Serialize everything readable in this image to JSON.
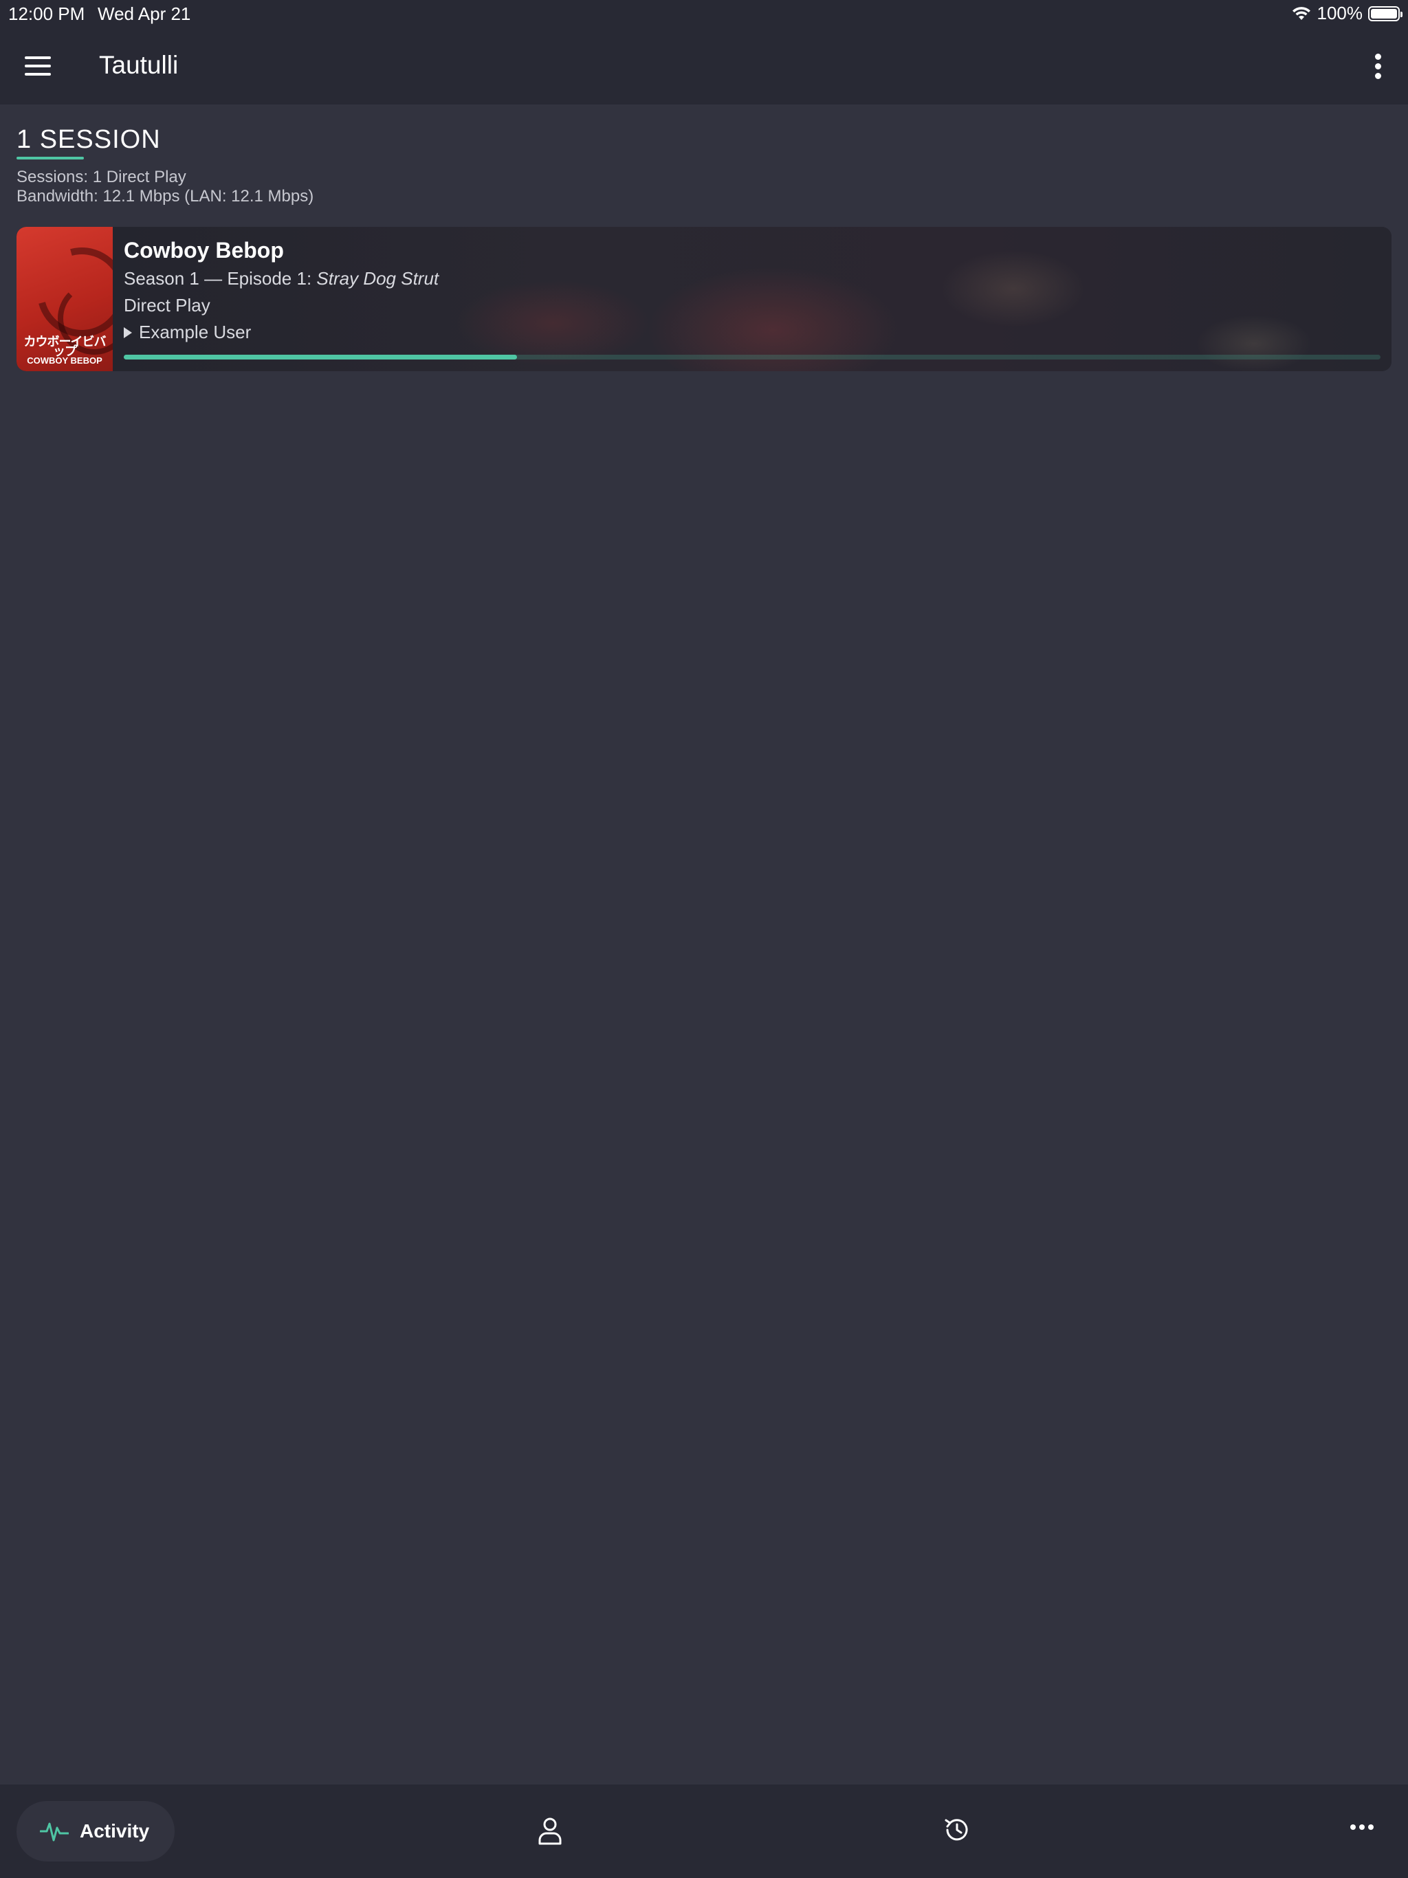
{
  "status_bar": {
    "time": "12:00 PM",
    "date": "Wed Apr 21",
    "battery": "100%",
    "battery_level": 1.0
  },
  "app_bar": {
    "title": "Tautulli",
    "menu_icon": "hamburger-menu-icon",
    "overflow_icon": "vertical-dots-icon"
  },
  "activity": {
    "heading": "1 SESSION",
    "sessions_line": "Sessions: 1 Direct Play",
    "bandwidth_line": "Bandwidth: 12.1 Mbps (LAN: 12.1 Mbps)",
    "sessions": [
      {
        "title": "Cowboy Bebop",
        "episode_prefix": "Season 1 — Episode 1: ",
        "episode_title": "Stray Dog Strut",
        "method": "Direct Play",
        "user": "Example User",
        "progress": 0.313,
        "poster_text_jp": "カウボーイビバップ",
        "poster_text_en": "COWBOY BEBOP"
      }
    ]
  },
  "bottom_nav": {
    "active_label": "Activity",
    "items": [
      {
        "name": "activity",
        "icon": "activity-pulse-icon",
        "label": "Activity"
      },
      {
        "name": "users",
        "icon": "user-icon"
      },
      {
        "name": "history",
        "icon": "history-icon"
      },
      {
        "name": "more",
        "icon": "more-horizontal-icon"
      }
    ]
  },
  "colors": {
    "accent": "#4fc6a4",
    "background": "#32333f",
    "bar": "#282934",
    "card": "#25262f"
  }
}
